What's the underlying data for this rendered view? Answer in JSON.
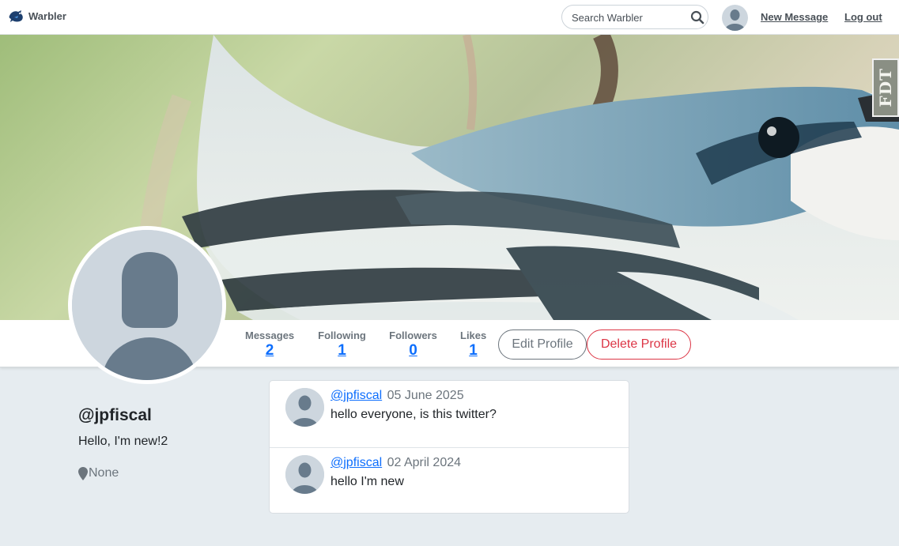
{
  "navbar": {
    "brand": "Warbler",
    "search_placeholder": "Search Warbler",
    "new_message": "New Message",
    "logout": "Log out"
  },
  "extension_badge": "FDT",
  "profile": {
    "username": "@jpfiscal",
    "bio": "Hello, I'm new!2",
    "location": "None"
  },
  "stats": {
    "messages": {
      "label": "Messages",
      "value": "2"
    },
    "following": {
      "label": "Following",
      "value": "1"
    },
    "followers": {
      "label": "Followers",
      "value": "0"
    },
    "likes": {
      "label": "Likes",
      "value": "1"
    }
  },
  "actions": {
    "edit": "Edit Profile",
    "delete": "Delete Profile"
  },
  "messages": [
    {
      "user": "@jpfiscal",
      "date": "05 June 2025",
      "text": "hello everyone, is this twitter?"
    },
    {
      "user": "@jpfiscal",
      "date": "02 April 2024",
      "text": "hello I'm new"
    }
  ],
  "colors": {
    "link": "#0d6efd",
    "danger": "#dc3545",
    "secondary": "#6c757d",
    "page_background": "#e6ecf0"
  },
  "icons": [
    "warbler-logo-icon",
    "search-icon",
    "avatar-icon",
    "map-marker-icon"
  ]
}
